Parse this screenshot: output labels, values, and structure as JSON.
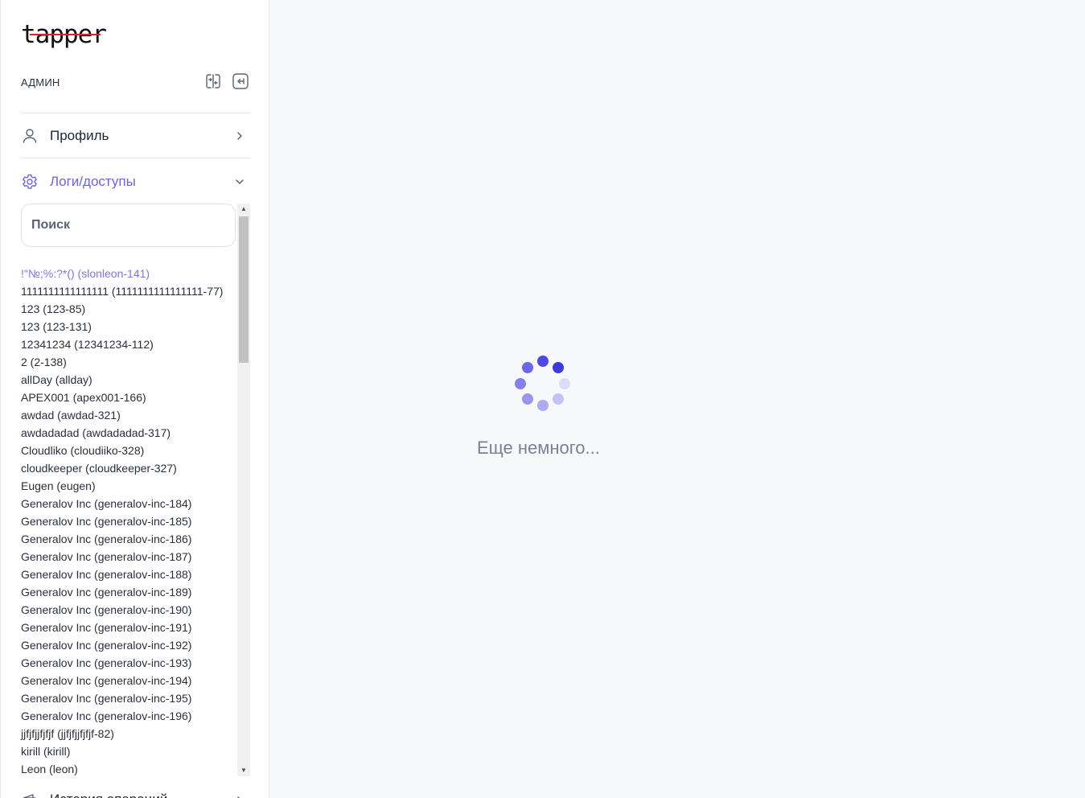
{
  "brand": {
    "logo_text": "tapper"
  },
  "user": {
    "name": "АДМИН"
  },
  "nav": {
    "profile_label": "Профиль",
    "logs_label": "Логи/доступы",
    "history_label": "История операций"
  },
  "search": {
    "placeholder": "Поиск"
  },
  "accounts": [
    "!\"№;%:?*() (slonleon-141)",
    "1111111111111111 (1111111111111111-77)",
    "123 (123-85)",
    "123 (123-131)",
    "12341234 (12341234-112)",
    "2 (2-138)",
    "allDay (allday)",
    "APEX001 (apex001-166)",
    "awdad (awdad-321)",
    "awdadadad (awdadadad-317)",
    "Cloudliko (cloudiiko-328)",
    "cloudkeeper (cloudkeeper-327)",
    "Eugen (eugen)",
    "Generalov Inc (generalov-inc-184)",
    "Generalov Inc (generalov-inc-185)",
    "Generalov Inc (generalov-inc-186)",
    "Generalov Inc (generalov-inc-187)",
    "Generalov Inc (generalov-inc-188)",
    "Generalov Inc (generalov-inc-189)",
    "Generalov Inc (generalov-inc-190)",
    "Generalov Inc (generalov-inc-191)",
    "Generalov Inc (generalov-inc-192)",
    "Generalov Inc (generalov-inc-193)",
    "Generalov Inc (generalov-inc-194)",
    "Generalov Inc (generalov-inc-195)",
    "Generalov Inc (generalov-inc-196)",
    "jjfjfjjfjfjf (jjfjfjjfjfjf-82)",
    "kirill (kirill)",
    "Leon (leon)"
  ],
  "loading": {
    "text": "Еще немного..."
  },
  "colors": {
    "accent": "#6b64e8",
    "logo_strike": "#d8232a",
    "loader_dot": "#4a44e6"
  },
  "icons": {
    "switch": "switch-account-icon",
    "logout": "logout-icon",
    "profile": "user-icon",
    "logs": "gear-icon",
    "history": "wallet-icon",
    "chevron_right": "chevron-right-icon",
    "chevron_down": "chevron-down-icon"
  }
}
